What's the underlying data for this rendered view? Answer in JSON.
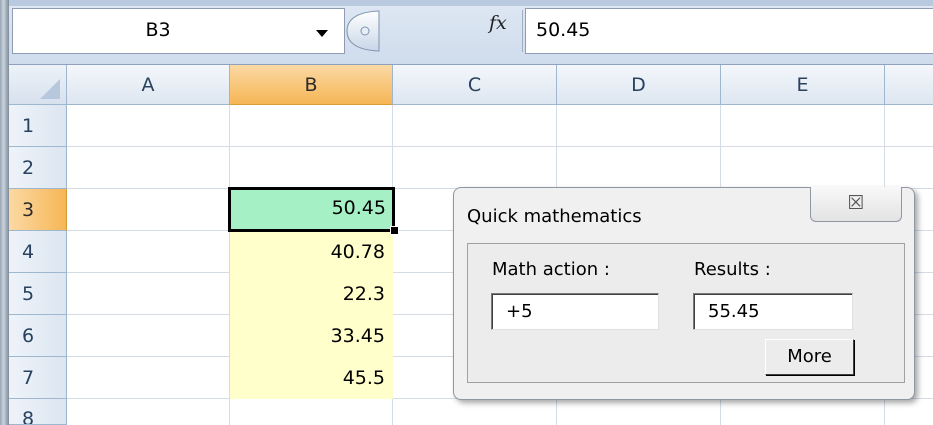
{
  "formula_bar": {
    "name_box": "B3",
    "fx_symbol": "fx",
    "formula_value": "50.45"
  },
  "columns": [
    "A",
    "B",
    "C",
    "D",
    "E"
  ],
  "rows": [
    "1",
    "2",
    "3",
    "4",
    "5",
    "6",
    "7",
    "8"
  ],
  "selected_cell": "B3",
  "cells": {
    "B3": "50.45",
    "B4": "40.78",
    "B5": "22.3",
    "B6": "33.45",
    "B7": "45.5"
  },
  "dialog": {
    "title": "Quick mathematics",
    "close_glyph": "☒",
    "math_action_label": "Math action :",
    "math_action_value": "+5",
    "results_label": "Results :",
    "results_value": "55.45",
    "more_label": "More"
  },
  "colors": {
    "selected_header": "#f6b656",
    "active_cell": "#a6f0c6",
    "highlighted_cells": "#ffffcc"
  }
}
